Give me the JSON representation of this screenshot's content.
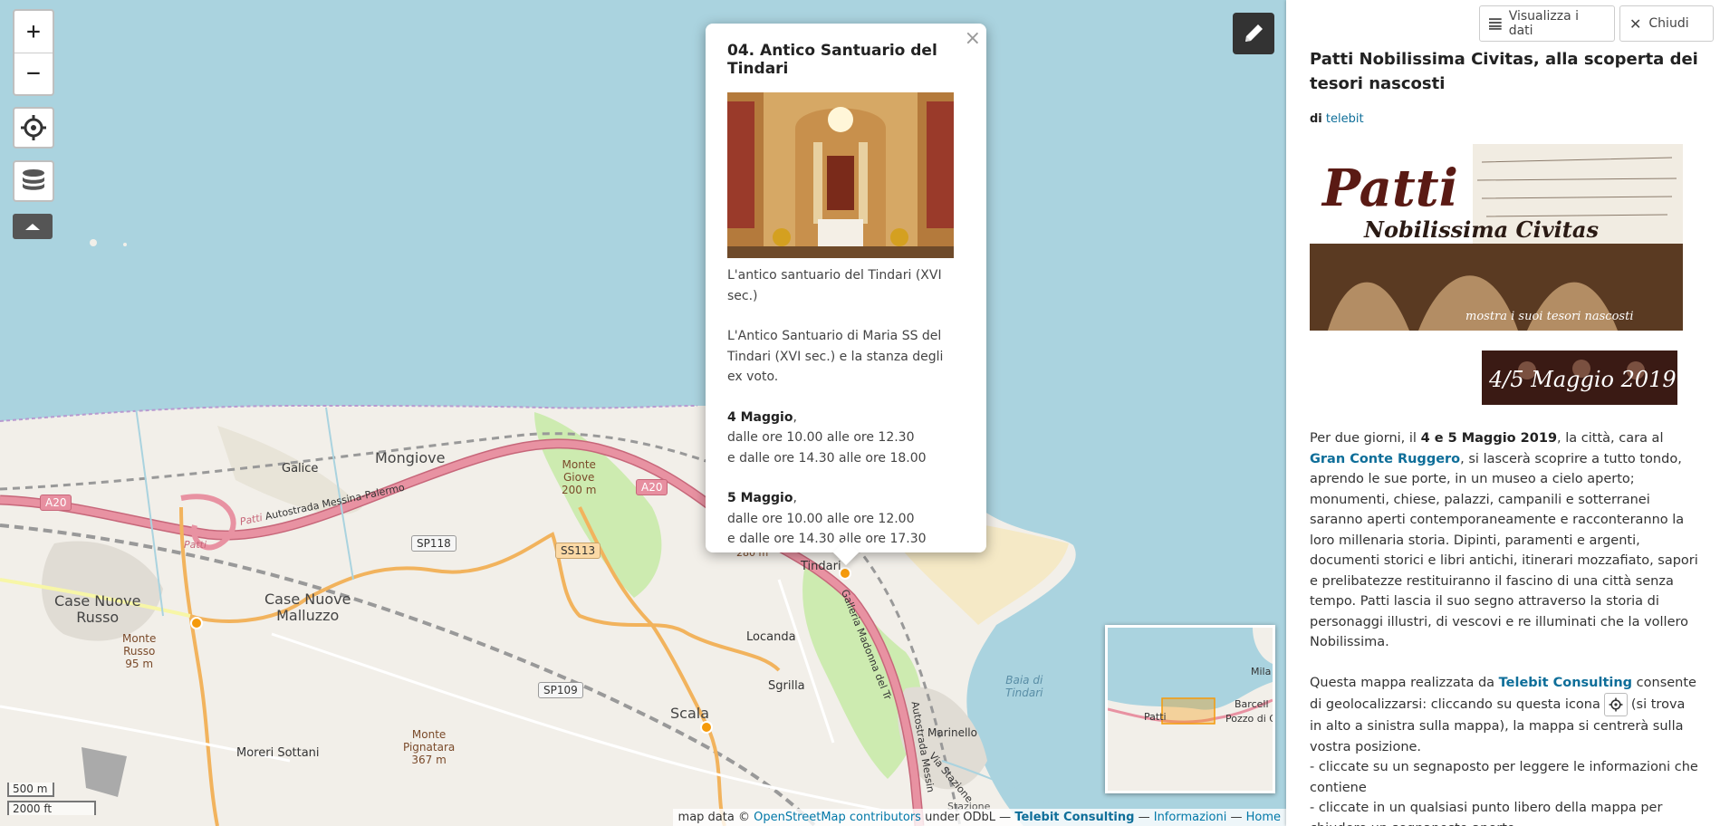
{
  "map": {
    "controls": {
      "zoom_in": "+",
      "zoom_out": "−"
    },
    "labels": {
      "galice": "Galice",
      "mongiove": "Mongiove",
      "monte_giove": [
        "Monte",
        "Giove",
        "200 m"
      ],
      "case_nuove_russo": [
        "Case Nuove",
        "Russo"
      ],
      "case_nuove_malluzzo": [
        "Case Nuove",
        "Malluzzo"
      ],
      "monte_russo": [
        "Monte",
        "Russo",
        "95 m"
      ],
      "tindari": "Tindari",
      "locanda": "Locanda",
      "sgrilla": "Sgrilla",
      "scala": "Scala",
      "monte_pignatara": [
        "Monte",
        "Pignatara",
        "367 m"
      ],
      "moreri_sottani": "Moreri Sottani",
      "baia_di_tindari": [
        "Baia di",
        "Tindari"
      ],
      "patti": "Patti",
      "autostrada": "Autostrada Messina-Palermo",
      "galleria": "Galleria Madonna del Tr",
      "autostrada_messina": "Autostrada Messin",
      "via_stazione": "Via Stazione",
      "marinello": "Marinello",
      "stazione": "Stazione",
      "elevation_280": "280 m"
    },
    "shields": {
      "a20_left": "A20",
      "a20_right": "A20",
      "sp118": "SP118",
      "ss113": "SS113",
      "sp109": "SP109"
    },
    "minimap_labels": {
      "patti": "Patti",
      "barcell": "Barcell",
      "mila": "Mila",
      "pozzo": "Pozzo di G"
    },
    "scale": {
      "metric": "500 m",
      "imperial": "2000 ft"
    },
    "attribution": {
      "prefix": "map data ©",
      "osm": "OpenStreetMap contributors",
      "license": "under ODbL —",
      "telebit": "Telebit Consulting",
      "sep1": "—",
      "info": "Informazioni",
      "sep2": "—",
      "home": "Home"
    }
  },
  "popup": {
    "close": "×",
    "title": "04. Antico Santuario del Tindari",
    "caption": "L'antico santuario del Tindari (XVI sec.)",
    "description": [
      "L'Antico Santuario di Maria SS del",
      "Tindari (XVI sec.) e la stanza degli",
      "ex voto."
    ],
    "day1": {
      "label": "4 Maggio",
      "comma": ",",
      "line1": "dalle ore 10.00 alle ore 12.30",
      "line2": "e dalle ore 14.30 alle ore 18.00"
    },
    "day2": {
      "label": "5 Maggio",
      "comma": ",",
      "line1": "dalle ore 10.00 alle ore 12.00",
      "line2": "e dalle ore 14.30 alle ore 17.30"
    }
  },
  "panel": {
    "buttons": {
      "view_data": "Visualizza i dati",
      "close": "Chiudi"
    },
    "title": "Patti Nobilissima Civitas, alla scoperta dei tesori nascosti",
    "byline_prefix": "di",
    "author": "telebit",
    "banner": {
      "line1": "Patti",
      "line2": "Nobilissima Civitas",
      "line3": "mostra i suoi tesori nascosti",
      "dates": "4/5 Maggio 2019"
    },
    "intro": {
      "t1": "Per due giorni, il ",
      "dates": "4 e 5 Maggio 2019",
      "t2": ", la città, cara al ",
      "link": "Gran Conte Ruggero",
      "t3": ", si lascerà scoprire a tutto tondo, aprendo le sue porte, in un museo a cielo aperto; monumenti, chiese, palazzi, campanili e sotterranei saranno aperti contemporaneamente e racconteranno la loro millenaria storia. Dipinti, paramenti e argenti, documenti storici e libri antichi, itinerari mozzafiato, sapori e prelibatezze restituiranno il fascino di una città senza tempo. Patti lascia il suo segno attraverso la storia di personaggi illustri, di vescovi e re illuminati che la vollero Nobilissima."
    },
    "howto": {
      "t1": "Questa mappa realizzata da ",
      "link": "Telebit Consulting",
      "t2": " consente di geolocalizzarsi: cliccando su questa icona",
      "t3": "(si trova in alto a sinistra sulla mappa), la mappa si centrerà sulla vostra posizione.",
      "b1": "- cliccate su un segnaposto per leggere le informazioni che contiene",
      "b2": "- cliccate in un qualsiasi punto libero della mappa per chiudere un segnaposto aperto."
    }
  }
}
